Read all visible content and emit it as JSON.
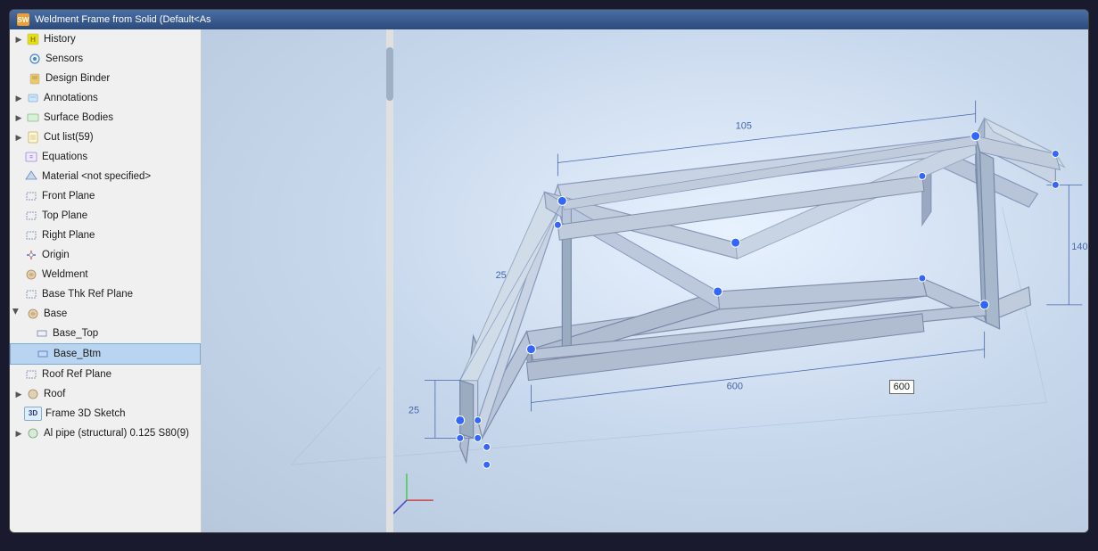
{
  "window": {
    "title": "Weldment Frame from Solid (Default<As",
    "icon": "SW"
  },
  "sidebar": {
    "items": [
      {
        "id": "history",
        "label": "History",
        "icon": "📋",
        "indent": 0,
        "expandable": true,
        "expanded": true
      },
      {
        "id": "sensors",
        "label": "Sensors",
        "icon": "📡",
        "indent": 1,
        "expandable": false
      },
      {
        "id": "design-binder",
        "label": "Design Binder",
        "icon": "📎",
        "indent": 1,
        "expandable": false
      },
      {
        "id": "annotations",
        "label": "Annotations",
        "icon": "📝",
        "indent": 0,
        "expandable": true
      },
      {
        "id": "surface-bodies",
        "label": "Surface Bodies",
        "icon": "⬜",
        "indent": 0,
        "expandable": false
      },
      {
        "id": "cut-list",
        "label": "Cut list(59)",
        "icon": "✂",
        "indent": 0,
        "expandable": true
      },
      {
        "id": "equations",
        "label": "Equations",
        "icon": "=",
        "indent": 0,
        "expandable": false
      },
      {
        "id": "material",
        "label": "Material <not specified>",
        "icon": "🔷",
        "indent": 0,
        "expandable": false
      },
      {
        "id": "front-plane",
        "label": "Front Plane",
        "icon": "▭",
        "indent": 0,
        "expandable": false
      },
      {
        "id": "top-plane",
        "label": "Top Plane",
        "icon": "▭",
        "indent": 0,
        "expandable": false
      },
      {
        "id": "right-plane",
        "label": "Right Plane",
        "icon": "▭",
        "indent": 0,
        "expandable": false
      },
      {
        "id": "origin",
        "label": "Origin",
        "icon": "⊕",
        "indent": 0,
        "expandable": false
      },
      {
        "id": "weldment",
        "label": "Weldment",
        "icon": "🔩",
        "indent": 0,
        "expandable": false
      },
      {
        "id": "base-thk",
        "label": "Base Thk Ref Plane",
        "icon": "▭",
        "indent": 0,
        "expandable": false
      },
      {
        "id": "base",
        "label": "Base",
        "icon": "🔩",
        "indent": 0,
        "expandable": true,
        "expanded": true
      },
      {
        "id": "base-top",
        "label": "Base_Top",
        "icon": "▭",
        "indent": 1,
        "expandable": false
      },
      {
        "id": "base-btm",
        "label": "Base_Btm",
        "icon": "▭",
        "indent": 1,
        "expandable": false,
        "selected": true
      },
      {
        "id": "roof-ref-plane",
        "label": "Roof Ref Plane",
        "icon": "▭",
        "indent": 0,
        "expandable": false
      },
      {
        "id": "roof",
        "label": "Roof",
        "icon": "🔩",
        "indent": 0,
        "expandable": true
      },
      {
        "id": "frame-3d",
        "label": "Frame 3D Sketch",
        "icon": "3D",
        "indent": 0,
        "expandable": false
      },
      {
        "id": "al-pipe",
        "label": "Al pipe (structural) 0.125  S80(9)",
        "icon": "🔩",
        "indent": 0,
        "expandable": true
      }
    ]
  },
  "viewport": {
    "dimension1": "600",
    "dimension2": "140",
    "dimension3": "105",
    "dimension4": "25",
    "dimension5": "25"
  }
}
